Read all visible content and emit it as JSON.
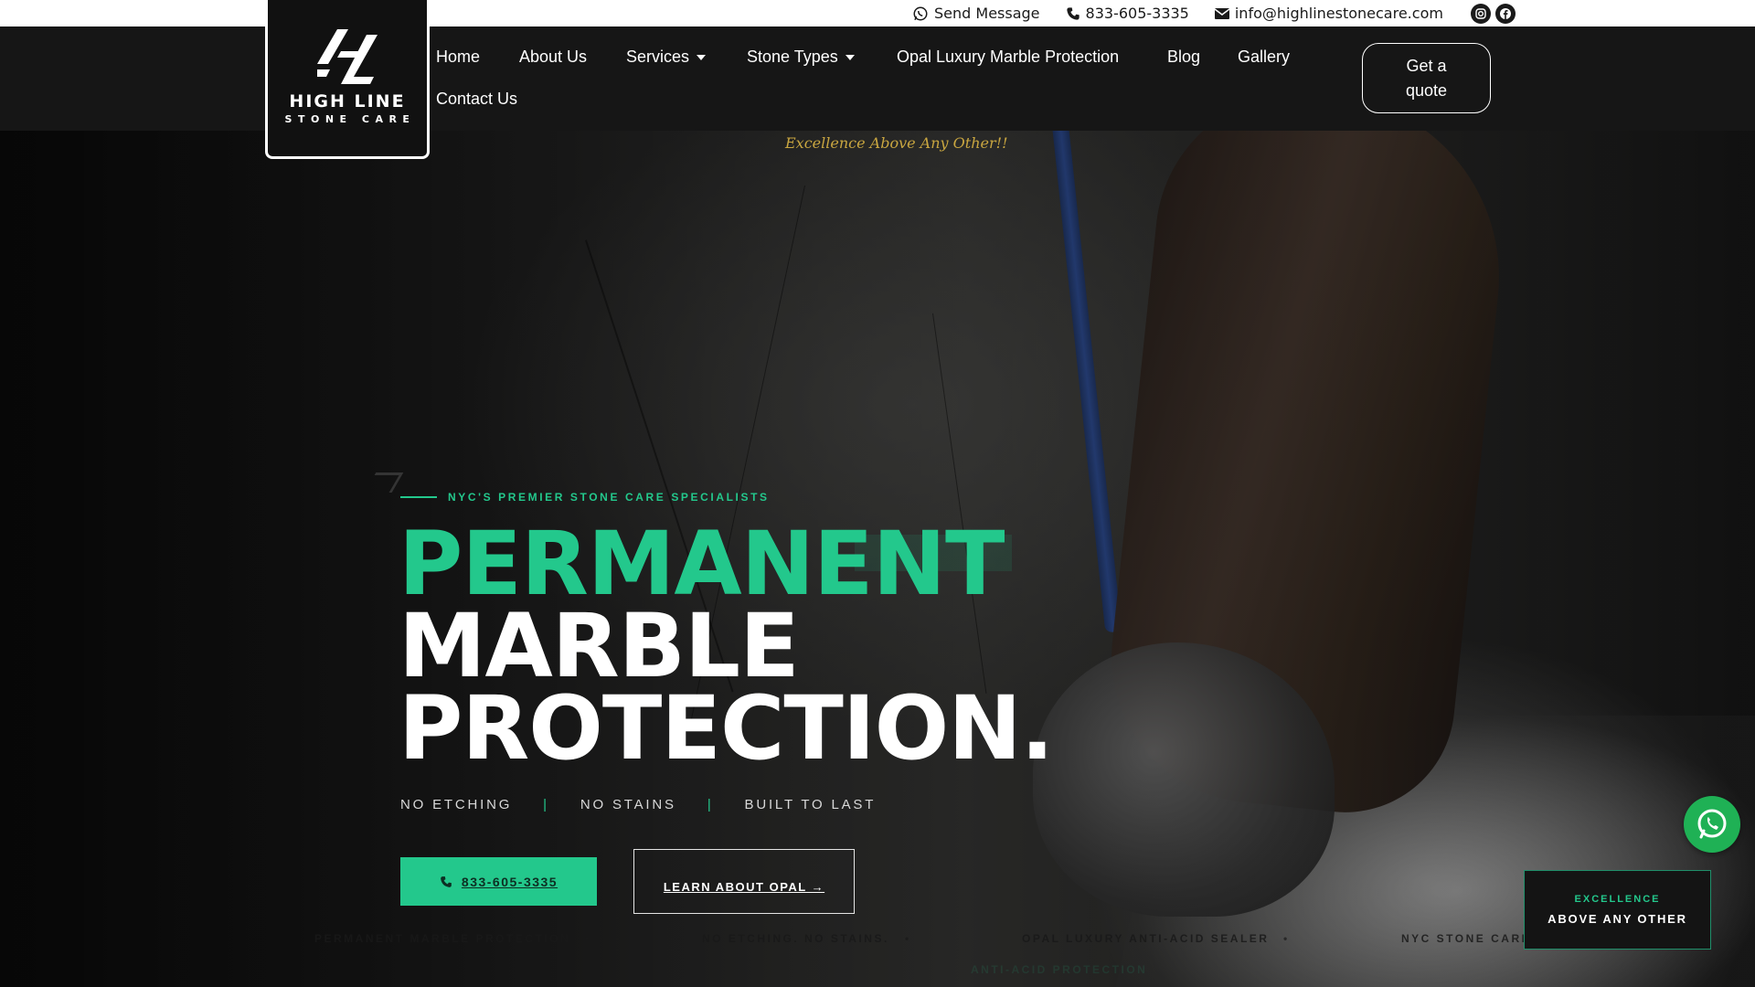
{
  "topbar": {
    "send_message": "Send Message",
    "phone": "833-605-3335",
    "email": "info@highlinestonecare.com",
    "social": [
      "instagram-icon",
      "facebook-icon"
    ]
  },
  "logo": {
    "line1": "HIGH LINE",
    "line2": "STONE CARE"
  },
  "nav": {
    "items": [
      "Home",
      "About Us",
      "Services",
      "Stone Types",
      "Opal Luxury Marble Protection",
      "Blog",
      "Gallery",
      "Contact Us"
    ],
    "quote_button": "Get a quote"
  },
  "hero": {
    "tagline": "Excellence Above Any Other!!",
    "eyebrow": "NYC'S PREMIER STONE CARE SPECIALISTS",
    "headline": [
      "PERMANENT",
      "MARBLE",
      "PROTECTION."
    ],
    "features": [
      "NO ETCHING",
      "NO STAINS",
      "BUILT TO LAST"
    ],
    "separator": "|",
    "cta_phone": "833-605-3335",
    "cta_opal": "LEARN ABOUT OPAL →"
  },
  "ticker": {
    "items": [
      "PERMANENT MARBLE PROTECTION",
      "NO ETCHING. NO STAINS.",
      "OPAL LUXURY ANTI-ACID SEALER",
      "NYC STONE CARE"
    ],
    "second_row": "ANTI-ACID PROTECTION",
    "dot": "•"
  },
  "badge": {
    "top": "EXCELLENCE",
    "bottom": "ABOVE ANY OTHER"
  },
  "colors": {
    "accent": "#23c88c",
    "gold": "#c9a640",
    "nav_bg": "#161616",
    "whatsapp": "#1fb155"
  }
}
